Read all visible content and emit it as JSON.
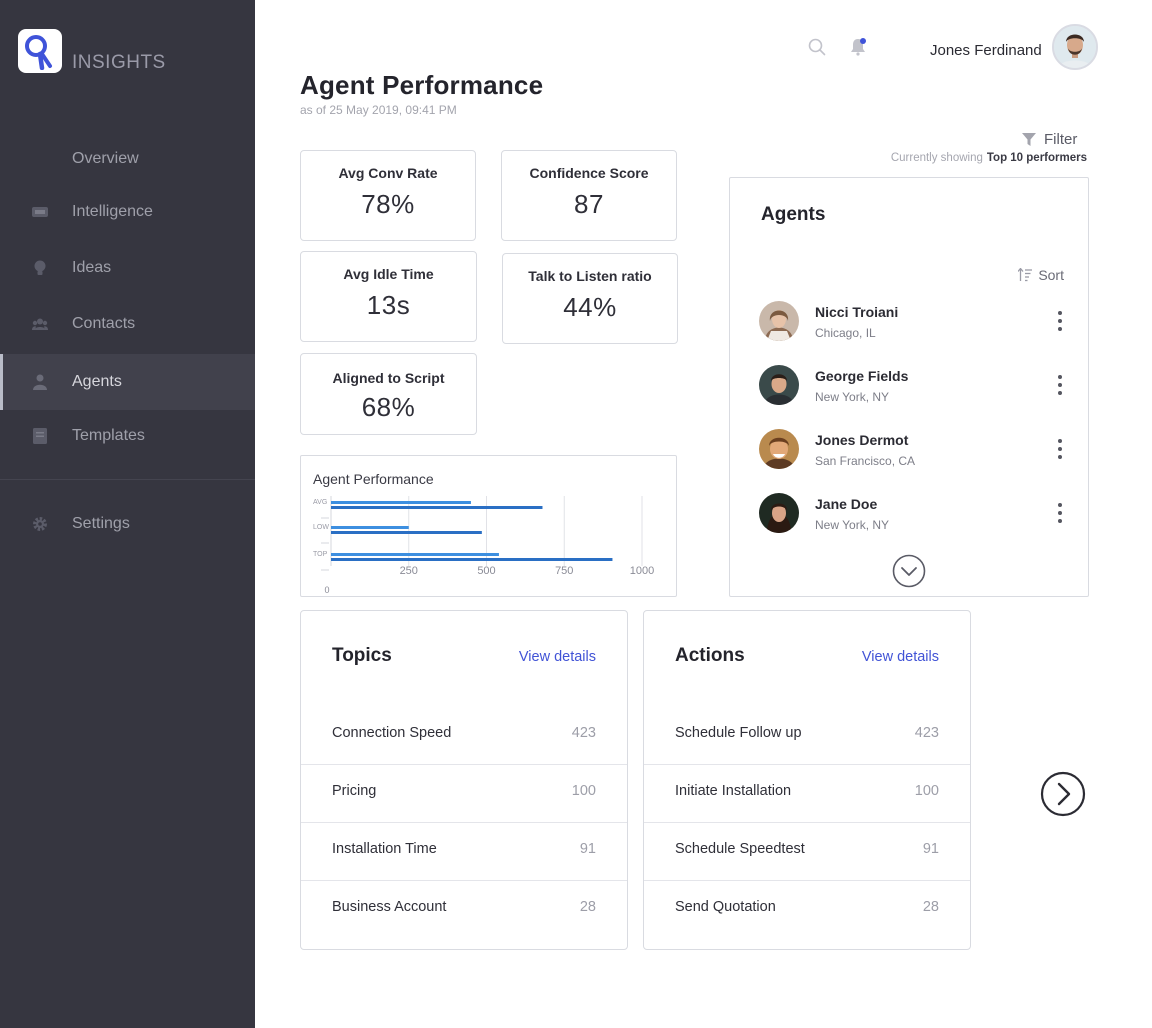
{
  "brand": {
    "name": "INSIGHTS"
  },
  "sidebar": {
    "items": [
      {
        "label": "Overview",
        "icon": "overview-icon"
      },
      {
        "label": "Intelligence",
        "icon": "intelligence-icon"
      },
      {
        "label": "Ideas",
        "icon": "lightbulb-icon"
      },
      {
        "label": "Contacts",
        "icon": "contacts-icon"
      },
      {
        "label": "Agents",
        "icon": "agent-icon",
        "active": true
      },
      {
        "label": "Templates",
        "icon": "template-icon"
      },
      {
        "label": "Settings",
        "icon": "gear-icon"
      }
    ]
  },
  "header": {
    "user_name": "Jones Ferdinand",
    "notification_dot_color": "#3f53d9"
  },
  "page": {
    "title": "Agent Performance",
    "subtitle": "as of 25 May 2019, 09:41 PM"
  },
  "stats": [
    {
      "label": "Avg Conv Rate",
      "value": "78%"
    },
    {
      "label": "Confidence Score",
      "value": "87"
    },
    {
      "label": "Avg Idle Time",
      "value": "13s"
    },
    {
      "label": "Talk to Listen ratio",
      "value": "44%"
    },
    {
      "label": "Aligned to Script",
      "value": "68%"
    }
  ],
  "chart_data": {
    "type": "bar",
    "orientation": "horizontal",
    "title": "Agent Performance",
    "categories": [
      "AVG",
      "LOW",
      "TOP"
    ],
    "series": [
      {
        "values": [
          450,
          250,
          540
        ],
        "color": "#3d8fe0"
      },
      {
        "values": [
          680,
          485,
          905
        ],
        "color": "#2a6fc4"
      }
    ],
    "xticks": [
      250,
      500,
      750,
      1000
    ],
    "xlim": [
      0,
      1000
    ],
    "origin_label": "0",
    "grid": true
  },
  "filter": {
    "label": "Filter",
    "showing_prefix": "Currently showing",
    "showing_value": "Top 10 performers"
  },
  "agents": {
    "title": "Agents",
    "sort_label": "Sort",
    "list": [
      {
        "name": "Nicci Troiani",
        "location": "Chicago, IL"
      },
      {
        "name": "George Fields",
        "location": "New York, NY"
      },
      {
        "name": "Jones Dermot",
        "location": "San Francisco, CA"
      },
      {
        "name": "Jane Doe",
        "location": "New York, NY"
      }
    ]
  },
  "topics": {
    "title": "Topics",
    "link": "View details",
    "rows": [
      {
        "label": "Connection Speed",
        "value": "423"
      },
      {
        "label": "Pricing",
        "value": "100"
      },
      {
        "label": "Installation Time",
        "value": "91"
      },
      {
        "label": "Business Account",
        "value": "28"
      }
    ]
  },
  "actions": {
    "title": "Actions",
    "link": "View details",
    "rows": [
      {
        "label": "Schedule Follow up",
        "value": "423"
      },
      {
        "label": "Initiate Installation",
        "value": "100"
      },
      {
        "label": "Schedule Speedtest",
        "value": "91"
      },
      {
        "label": "Send Quotation",
        "value": "28"
      }
    ]
  },
  "colors": {
    "sidebar_bg": "#363640",
    "accent": "#4153d6",
    "bar_light": "#3d8fe0",
    "bar_dark": "#2a6fc4"
  }
}
